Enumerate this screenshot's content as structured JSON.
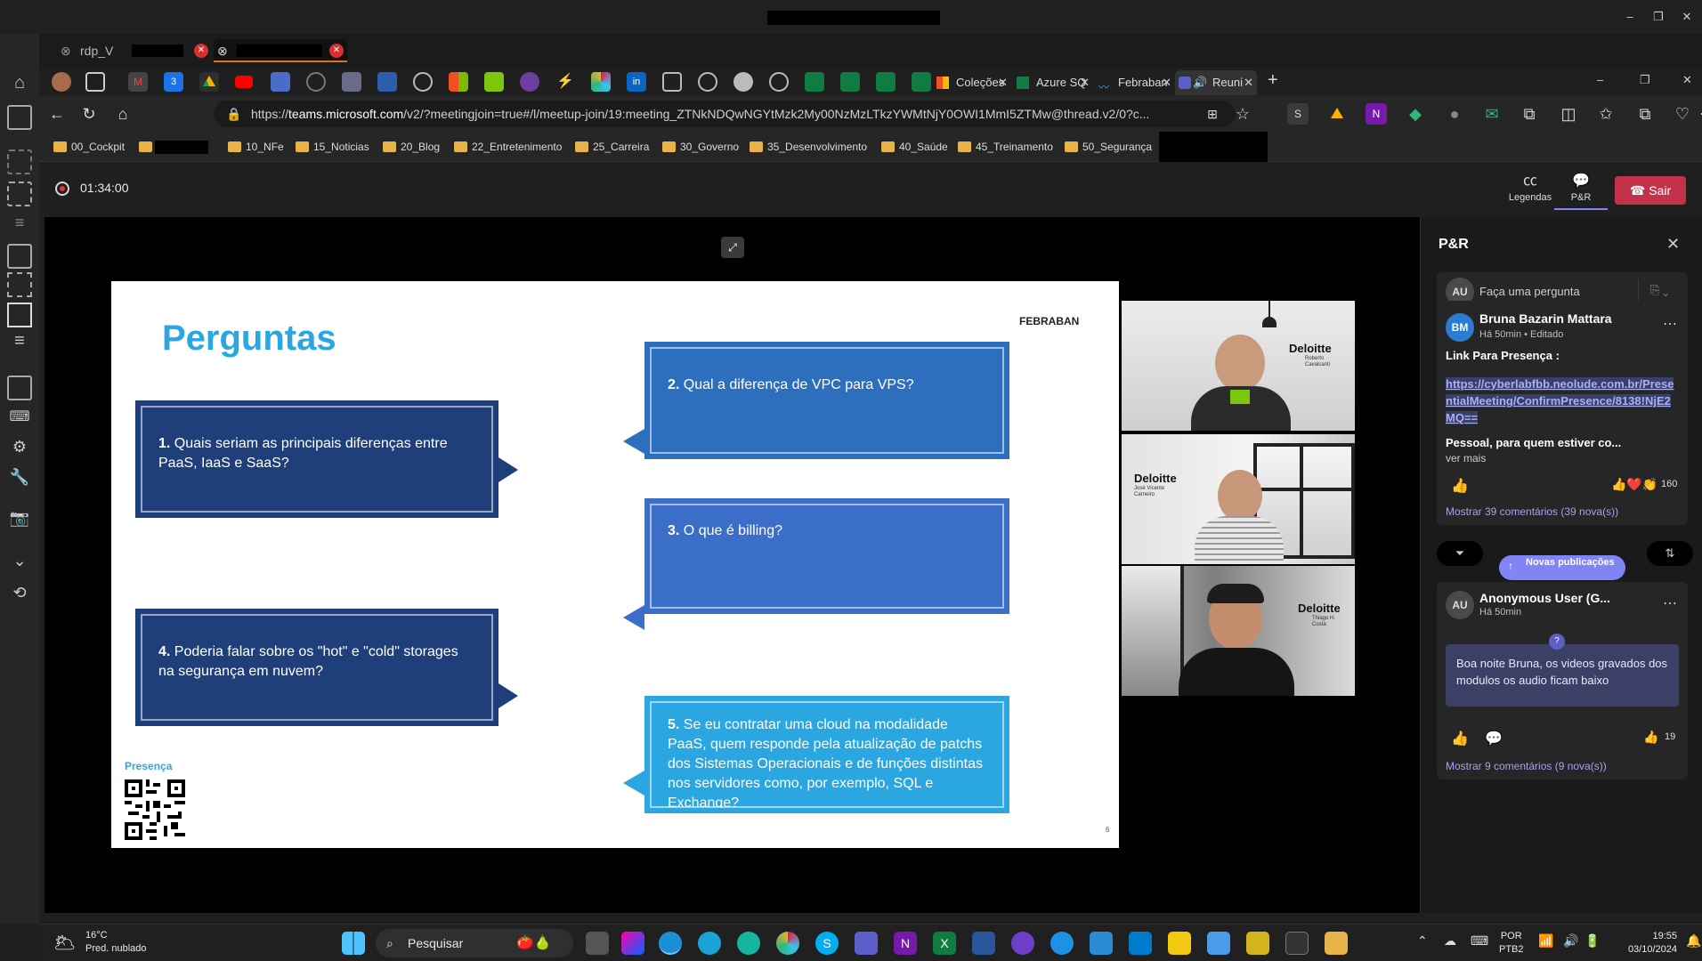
{
  "rdp": {
    "tabs": [
      {
        "label": "rdp_V"
      },
      {
        "label": ""
      }
    ]
  },
  "browser": {
    "tabs": [
      {
        "label": "Coleções"
      },
      {
        "label": "Azure SQ"
      },
      {
        "label": "Febraban"
      },
      {
        "label": "Reuni"
      }
    ],
    "url_prefix": "https://",
    "url_host": "teams.microsoft.com",
    "url_path": "/v2/?meetingjoin=true#/l/meetup-join/19:meeting_ZTNkNDQwNGYtMzk2My00NzMzLTkzYWMtNjY0OWI1MmI5ZTMw@thread.v2/0?c...",
    "bookmarks": [
      "00_Cockpit",
      "10_NFe",
      "15_Noticias",
      "20_Blog",
      "22_Entretenimento",
      "25_Carreira",
      "30_Governo",
      "35_Desenvolvimento",
      "40_Saúde",
      "45_Treinamento",
      "50_Segurança"
    ]
  },
  "meeting": {
    "recording_time": "01:34:00",
    "captions_label": "Legendas",
    "qa_label": "P&R",
    "leave_label": "Sair"
  },
  "slide": {
    "title": "Perguntas",
    "brand": "FEBRABAN",
    "questions": [
      {
        "num": "1.",
        "text": "Quais seriam as principais diferenças entre PaaS, IaaS e SaaS?"
      },
      {
        "num": "2.",
        "text": "Qual a diferença de VPC para VPS?"
      },
      {
        "num": "3.",
        "text": "O que é billing?"
      },
      {
        "num": "4.",
        "text": "Poderia falar sobre os \"hot\" e \"cold\" storages na segurança em nuvem?"
      },
      {
        "num": "5.",
        "text": "Se eu contratar uma cloud na modalidade PaaS, quem responde pela atualização de patchs dos Sistemas Operacionais e de funções distintas nos servidores como, por exemplo, SQL e Exchange?"
      }
    ],
    "presence_label": "Presença",
    "page_number": "6"
  },
  "videos": [
    {
      "brand": "Deloitte",
      "caption": "Roberto Cavalcanti"
    },
    {
      "brand": "Deloitte",
      "caption": "José Vicente Carneiro"
    },
    {
      "brand": "Deloitte",
      "caption": "Thiago H. Costa"
    }
  ],
  "qa": {
    "title": "P&R",
    "ask_avatar": "AU",
    "ask_placeholder": "Faça uma pergunta",
    "post1": {
      "avatar": "BM",
      "author": "Bruna Bazarin Mattara",
      "time": "Há 50min",
      "edited": "Editado",
      "heading": "Link Para Presença :",
      "link": "https://cyberlabfbb.neolude.com.br/PresentialMeeting/ConfirmPresence/8138!NjE2MQ==",
      "teaser": "Pessoal, para quem estiver co...",
      "see_more": "ver mais",
      "reactions_count": "160",
      "comments": "Mostrar 39 comentários (39 nova(s))"
    },
    "new_posts_label": "Novas publicações",
    "post2": {
      "avatar": "AU",
      "author": "Anonymous User (G...",
      "time": "Há 50min",
      "body": "Boa noite Bruna, os videos gravados dos modulos os audio ficam baixo",
      "reactions_count": "19",
      "comments": "Mostrar 9 comentários (9 nova(s))"
    }
  },
  "taskbar": {
    "weather_temp": "16°C",
    "weather_desc": "Pred. nublado",
    "search_placeholder": "Pesquisar",
    "lang1": "POR",
    "lang2": "PTB2",
    "time": "19:55",
    "date": "03/10/2024"
  },
  "colors": {
    "slide_dark_blue": "#1f3f7a",
    "slide_mid_blue": "#2e6fbd",
    "slide_light_blue": "#2aa7e0",
    "leave_red": "#c4314b",
    "teams_purple": "#5b5fc7"
  }
}
